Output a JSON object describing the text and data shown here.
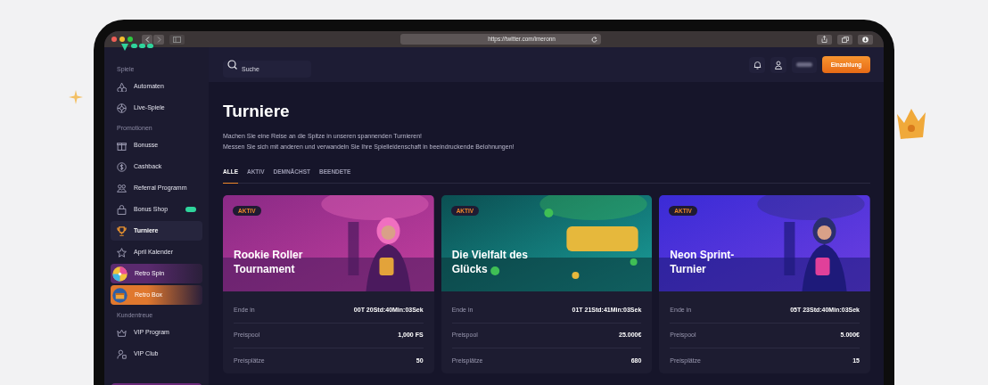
{
  "browser": {
    "url": "https://twitter.com/imeronn"
  },
  "sidebar": {
    "sections": [
      {
        "title": "Spiele",
        "items": [
          {
            "label": "Automaten",
            "selected": false,
            "kind": "link"
          },
          {
            "label": "Live-Spiele",
            "selected": false,
            "kind": "link"
          }
        ]
      },
      {
        "title": "Promotionen",
        "items": [
          {
            "label": "Bonusse",
            "selected": false,
            "kind": "link"
          },
          {
            "label": "Cashback",
            "selected": false,
            "kind": "link"
          },
          {
            "label": "Referral Programm",
            "selected": false,
            "kind": "link"
          },
          {
            "label": "Bonus Shop",
            "selected": false,
            "kind": "link",
            "badge": true
          },
          {
            "label": "Turniere",
            "selected": true,
            "kind": "link"
          },
          {
            "label": "April Kalender",
            "selected": false,
            "kind": "link"
          },
          {
            "label": "Retro Spin",
            "selected": false,
            "kind": "promo",
            "color": "#5a2a6e"
          },
          {
            "label": "Retro Box",
            "selected": false,
            "kind": "promo",
            "color": "#e0782e"
          }
        ]
      },
      {
        "title": "Kundentreue",
        "items": [
          {
            "label": "VIP Program",
            "selected": false,
            "kind": "link"
          },
          {
            "label": "VIP Club",
            "selected": false,
            "kind": "link"
          }
        ]
      }
    ]
  },
  "topbar": {
    "search": {
      "placeholder": "Suche"
    },
    "deposit_button": "Einzahlung"
  },
  "page": {
    "title": "Turniere",
    "description": [
      "Machen Sie eine Reise an die Spitze in unseren spannenden Turnieren!",
      "Messen Sie sich mit anderen und verwandeln Sie Ihre Spielleidenschaft in beeindruckende Belohnungen!"
    ]
  },
  "tabs": [
    {
      "label": "ALLE",
      "selected": true
    },
    {
      "label": "AKTIV",
      "selected": false
    },
    {
      "label": "DEMNÄCHST",
      "selected": false
    },
    {
      "label": "BEENDETE",
      "selected": false
    }
  ],
  "tournaments": [
    {
      "status": "AKTIV",
      "title": "Rookie Roller Tournament",
      "image": {
        "kind": "picture"
      },
      "rows": [
        {
          "label": "Ende in",
          "value": "00T 20Std:40Min:03Sek"
        },
        {
          "label": "Preispool",
          "value": "1,000 FS"
        },
        {
          "label": "Preisplätze",
          "value": "50"
        }
      ]
    },
    {
      "status": "AKTIV",
      "title": "Die Vielfalt des Glücks",
      "image": {
        "kind": "picture"
      },
      "rows": [
        {
          "label": "Ende in",
          "value": "01T 21Std:41Min:03Sek"
        },
        {
          "label": "Preispool",
          "value": "25.000€"
        },
        {
          "label": "Preisplätze",
          "value": "680"
        }
      ]
    },
    {
      "status": "AKTIV",
      "title": "Neon Sprint-Turnier",
      "image": {
        "kind": "picture"
      },
      "rows": [
        {
          "label": "Ende in",
          "value": "05T 23Std:40Min:03Sek"
        },
        {
          "label": "Preispool",
          "value": "5.000€"
        },
        {
          "label": "Preisplätze",
          "value": "15"
        }
      ]
    }
  ]
}
